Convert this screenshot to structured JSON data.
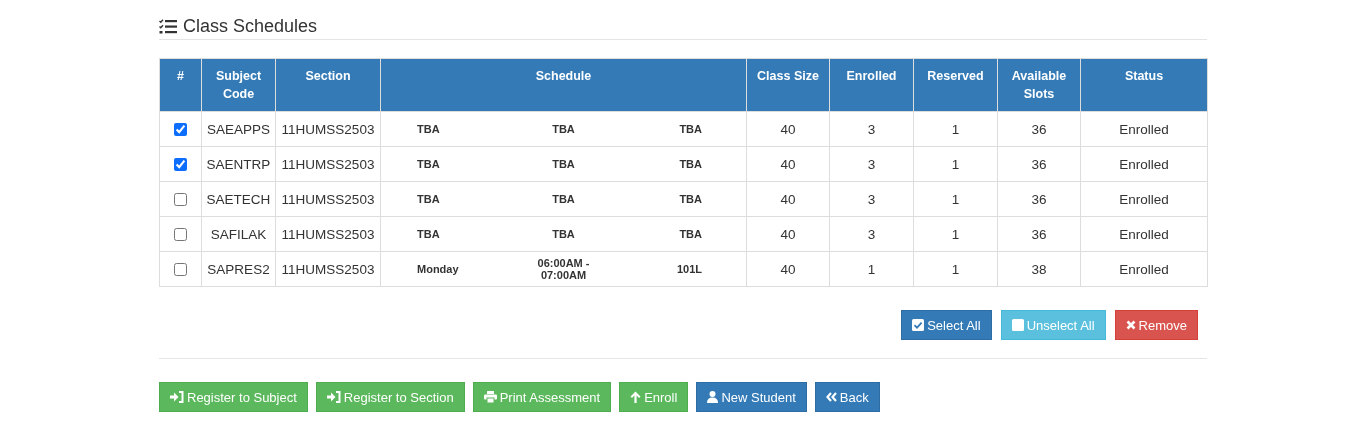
{
  "title": "Class Schedules",
  "table": {
    "columns": [
      "#",
      "Subject Code",
      "Section",
      "Schedule",
      "Class Size",
      "Enrolled",
      "Reserved",
      "Available Slots",
      "Status"
    ],
    "rows": [
      {
        "checked": true,
        "subject_code": "SAEAPPS",
        "section": "11HUMSS2503",
        "schedule": {
          "day": "TBA",
          "time": "TBA",
          "room": "TBA"
        },
        "class_size": "40",
        "enrolled": "3",
        "reserved": "1",
        "available_slots": "36",
        "status": "Enrolled"
      },
      {
        "checked": true,
        "subject_code": "SAENTRP",
        "section": "11HUMSS2503",
        "schedule": {
          "day": "TBA",
          "time": "TBA",
          "room": "TBA"
        },
        "class_size": "40",
        "enrolled": "3",
        "reserved": "1",
        "available_slots": "36",
        "status": "Enrolled"
      },
      {
        "checked": false,
        "subject_code": "SAETECH",
        "section": "11HUMSS2503",
        "schedule": {
          "day": "TBA",
          "time": "TBA",
          "room": "TBA"
        },
        "class_size": "40",
        "enrolled": "3",
        "reserved": "1",
        "available_slots": "36",
        "status": "Enrolled"
      },
      {
        "checked": false,
        "subject_code": "SAFILAK",
        "section": "11HUMSS2503",
        "schedule": {
          "day": "TBA",
          "time": "TBA",
          "room": "TBA"
        },
        "class_size": "40",
        "enrolled": "3",
        "reserved": "1",
        "available_slots": "36",
        "status": "Enrolled"
      },
      {
        "checked": false,
        "subject_code": "SAPRES2",
        "section": "11HUMSS2503",
        "schedule": {
          "day": "Monday",
          "time": "06:00AM - 07:00AM",
          "room": "101L"
        },
        "class_size": "40",
        "enrolled": "1",
        "reserved": "1",
        "available_slots": "38",
        "status": "Enrolled"
      }
    ]
  },
  "table_actions": [
    {
      "label": "Select All",
      "kind": "select-all"
    },
    {
      "label": "Unselect All",
      "kind": "unselect-all"
    },
    {
      "label": "Remove",
      "kind": "remove"
    }
  ],
  "actions": [
    {
      "label": "Register to Subject",
      "kind": "register-subject"
    },
    {
      "label": "Register to Section",
      "kind": "register-section"
    },
    {
      "label": "Print Assessment",
      "kind": "print"
    },
    {
      "label": "Enroll",
      "kind": "enroll"
    },
    {
      "label": "New Student",
      "kind": "new-student"
    },
    {
      "label": "Back",
      "kind": "back"
    }
  ]
}
